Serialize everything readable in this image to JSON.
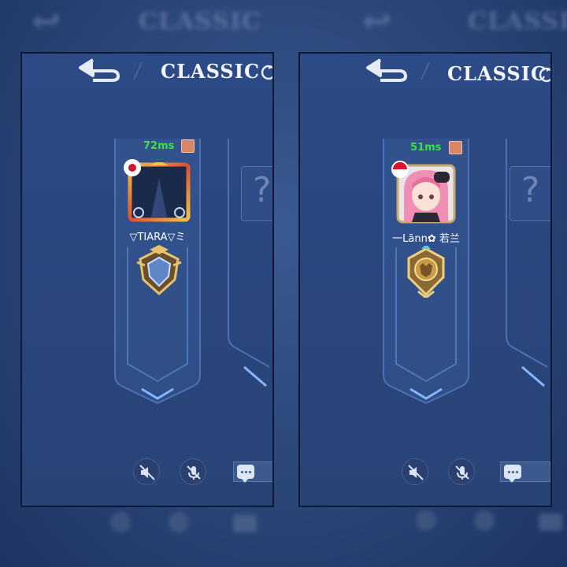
{
  "mode_title": "CLASSIC",
  "panels": {
    "left": {
      "ping": "72ms",
      "player_name": "▽TIARA▽ミ",
      "flag": "japan",
      "rank_badge": "mythic-gold-badge"
    },
    "right": {
      "ping": "51ms",
      "player_name": "一Lānn✿ 若兰",
      "flag": "indonesia",
      "rank_badge": "gold-lion-badge"
    }
  },
  "unknown_slot_symbol": "?",
  "icons": [
    "back-arrow-icon",
    "refresh-icon",
    "home-icon",
    "speaker-muted-icon",
    "mic-muted-icon",
    "chat-icon"
  ],
  "colors": {
    "ping": "#3fdc4c",
    "panel_bg": "#2c4a86",
    "title": "#f3f4f8"
  }
}
